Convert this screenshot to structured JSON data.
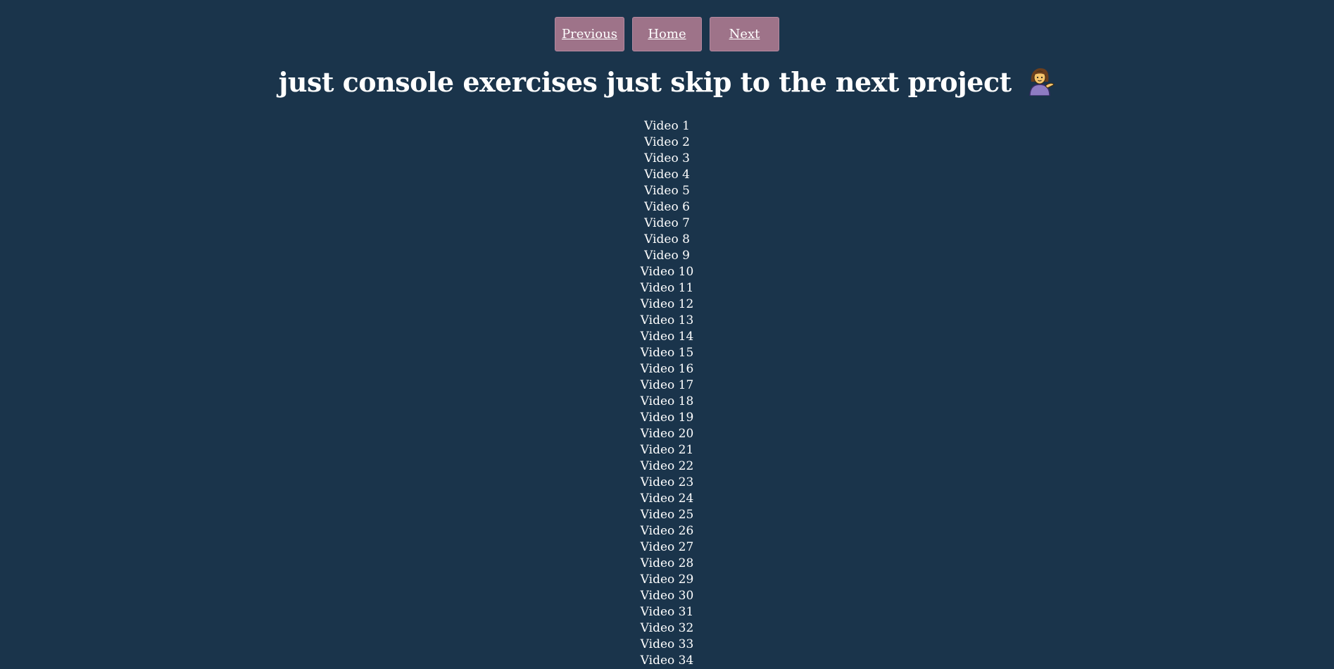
{
  "nav": {
    "previous_label": "Previous",
    "home_label": "Home",
    "next_label": "Next"
  },
  "page_title": "just console exercises just skip to the next project",
  "title_icon": "person-tipping-hand-icon",
  "colors": {
    "background": "#1a344b",
    "button": "#9e7389",
    "text": "#ffffff"
  },
  "videos": [
    "Video 1",
    "Video 2",
    "Video 3",
    "Video 4",
    "Video 5",
    "Video 6",
    "Video 7",
    "Video 8",
    "Video 9",
    "Video 10",
    "Video 11",
    "Video 12",
    "Video 13",
    "Video 14",
    "Video 15",
    "Video 16",
    "Video 17",
    "Video 18",
    "Video 19",
    "Video 20",
    "Video 21",
    "Video 22",
    "Video 23",
    "Video 24",
    "Video 25",
    "Video 26",
    "Video 27",
    "Video 28",
    "Video 29",
    "Video 30",
    "Video 31",
    "Video 32",
    "Video 33",
    "Video 34"
  ]
}
